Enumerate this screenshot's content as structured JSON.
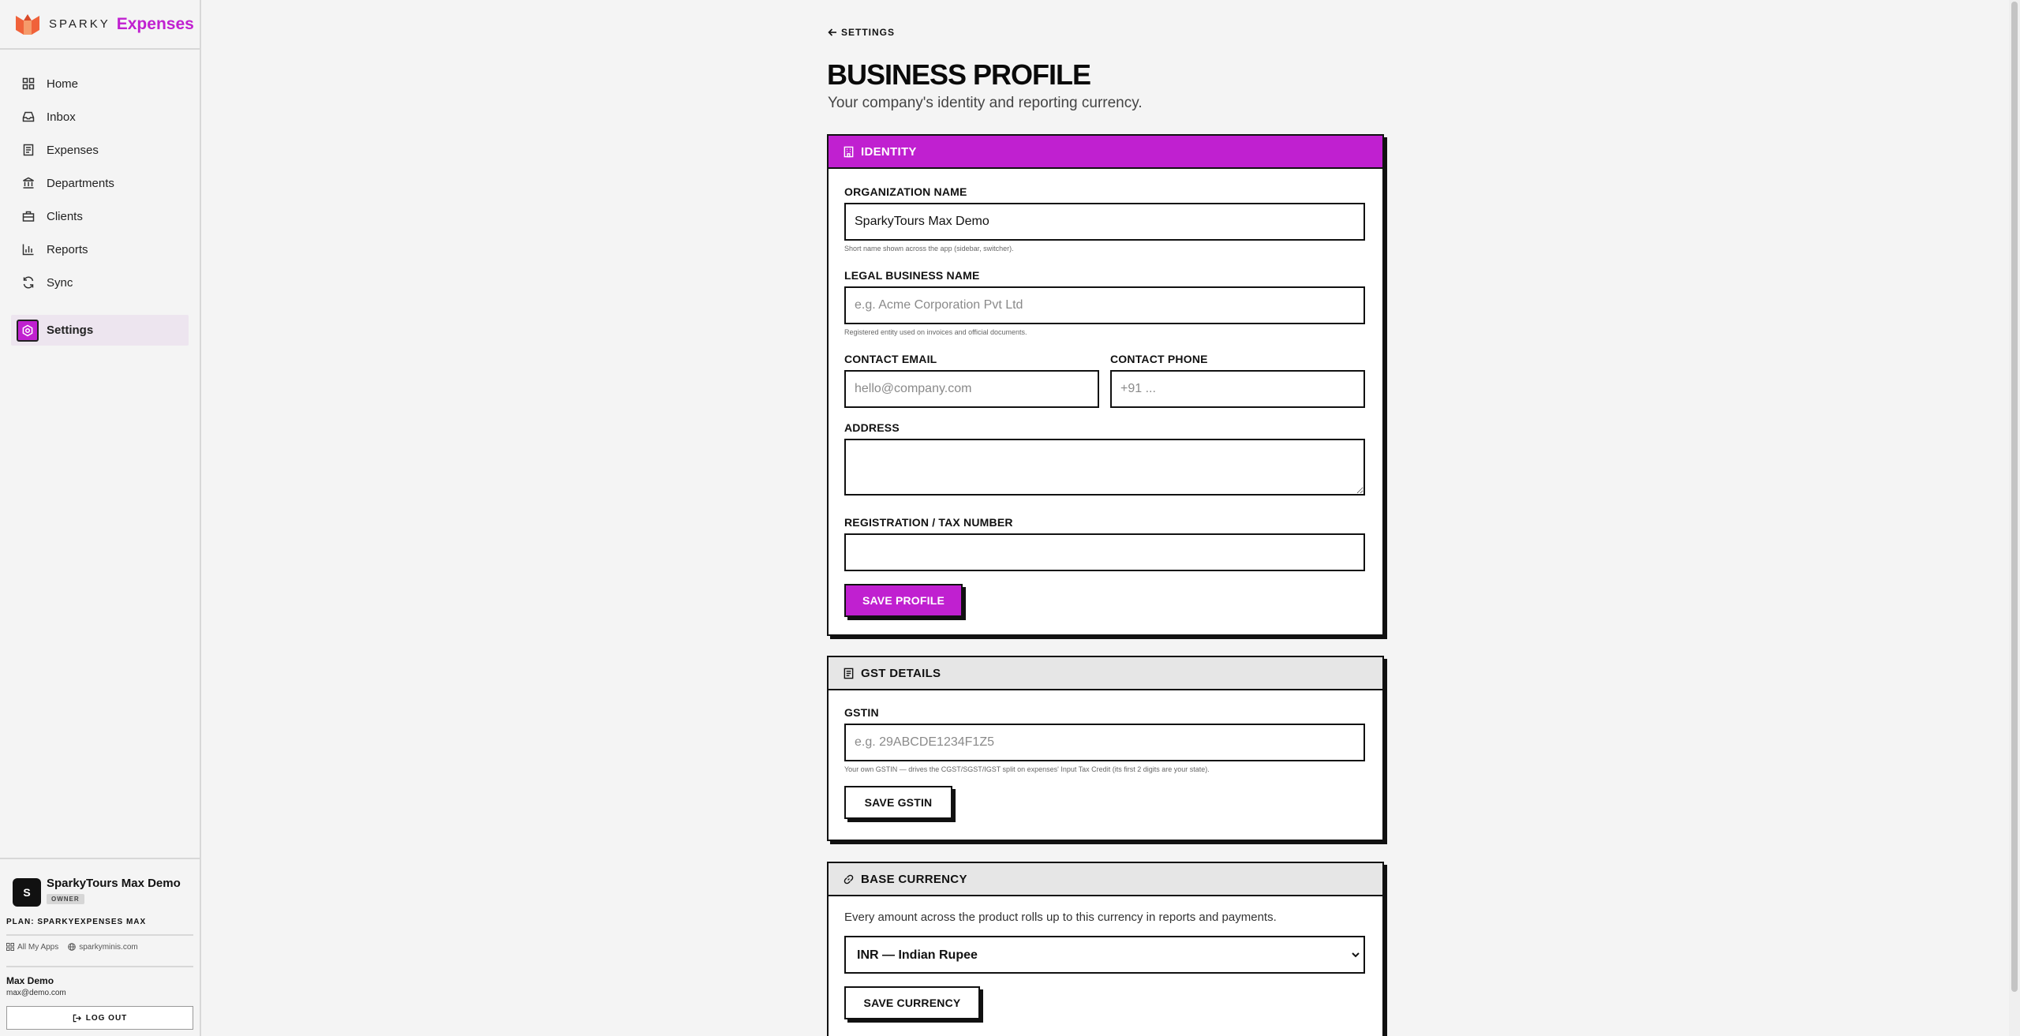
{
  "brand": {
    "name": "SPARKY",
    "product": "Expenses",
    "accent": "#c020d0"
  },
  "nav": {
    "items": [
      {
        "label": "Home",
        "icon": "home-icon"
      },
      {
        "label": "Inbox",
        "icon": "inbox-icon"
      },
      {
        "label": "Expenses",
        "icon": "receipt-icon"
      },
      {
        "label": "Departments",
        "icon": "building-icon"
      },
      {
        "label": "Clients",
        "icon": "briefcase-icon"
      },
      {
        "label": "Reports",
        "icon": "bar-chart-icon"
      },
      {
        "label": "Sync",
        "icon": "refresh-icon"
      }
    ],
    "settings": {
      "label": "Settings",
      "icon": "gear-icon"
    }
  },
  "org": {
    "avatar": "S",
    "name": "SparkyTours Max Demo",
    "role": "OWNER",
    "plan": "PLAN: SPARKYEXPENSES MAX"
  },
  "links": {
    "all_apps": "All My Apps",
    "site": "sparkyminis.com"
  },
  "user": {
    "name": "Max Demo",
    "email": "max@demo.com",
    "logout": "LOG OUT"
  },
  "page": {
    "back_label": "SETTINGS",
    "title": "BUSINESS PROFILE",
    "subtitle": "Your company's identity and reporting currency."
  },
  "identity": {
    "header": "IDENTITY",
    "org_name": {
      "label": "ORGANIZATION NAME",
      "value": "SparkyTours Max Demo",
      "hint": "Short name shown across the app (sidebar, switcher)."
    },
    "legal_name": {
      "label": "LEGAL BUSINESS NAME",
      "placeholder": "e.g. Acme Corporation Pvt Ltd",
      "hint": "Registered entity used on invoices and official documents."
    },
    "email": {
      "label": "CONTACT EMAIL",
      "placeholder": "hello@company.com"
    },
    "phone": {
      "label": "CONTACT PHONE",
      "placeholder": "+91 ..."
    },
    "address": {
      "label": "ADDRESS"
    },
    "tax": {
      "label": "REGISTRATION / TAX NUMBER"
    },
    "save_label": "SAVE PROFILE"
  },
  "gst": {
    "header": "GST DETAILS",
    "label": "GSTIN",
    "placeholder": "e.g. 29ABCDE1234F1Z5",
    "hint": "Your own GSTIN — drives the CGST/SGST/IGST split on expenses' Input Tax Credit (its first 2 digits are your state).",
    "save_label": "SAVE GSTIN"
  },
  "currency": {
    "header": "BASE CURRENCY",
    "description": "Every amount across the product rolls up to this currency in reports and payments.",
    "selected": "INR — Indian Rupee",
    "save_label": "SAVE CURRENCY"
  }
}
